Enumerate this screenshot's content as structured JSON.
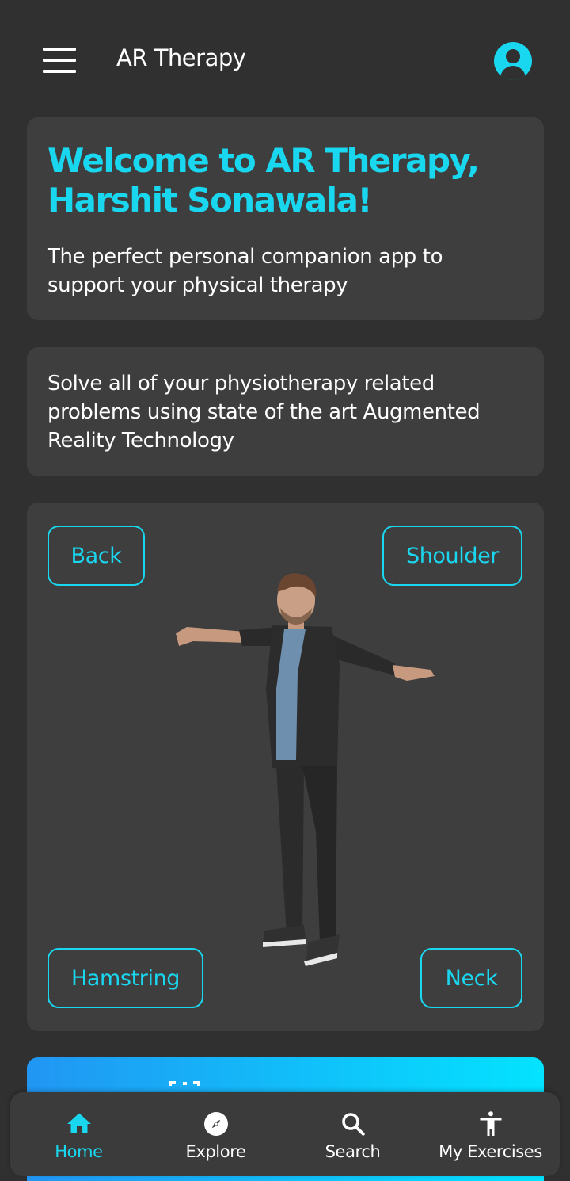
{
  "app_bar": {
    "title": "AR Therapy",
    "menu_icon": "menu-icon",
    "profile_icon": "account-circle-icon"
  },
  "welcome": {
    "title": "Welcome to AR Therapy, Harshit Sonawala!",
    "subtitle": "The perfect personal companion app to support your physical therapy"
  },
  "info": {
    "text": "Solve all of your physiotherapy related problems using state of the art Augmented Reality Technology"
  },
  "model_card": {
    "buttons": {
      "back": "Back",
      "shoulder": "Shoulder",
      "hamstring": "Hamstring",
      "neck": "Neck"
    }
  },
  "bottom_nav": {
    "items": [
      {
        "label": "Home",
        "icon": "home-icon",
        "active": true
      },
      {
        "label": "Explore",
        "icon": "compass-icon",
        "active": false
      },
      {
        "label": "Search",
        "icon": "search-icon",
        "active": false
      },
      {
        "label": "My Exercises",
        "icon": "accessibility-icon",
        "active": false
      }
    ]
  },
  "colors": {
    "background": "#303030",
    "card": "#3e3e3e",
    "accent": "#1ad7f0",
    "banner_start": "#2196f3",
    "banner_end": "#03e3ff"
  }
}
